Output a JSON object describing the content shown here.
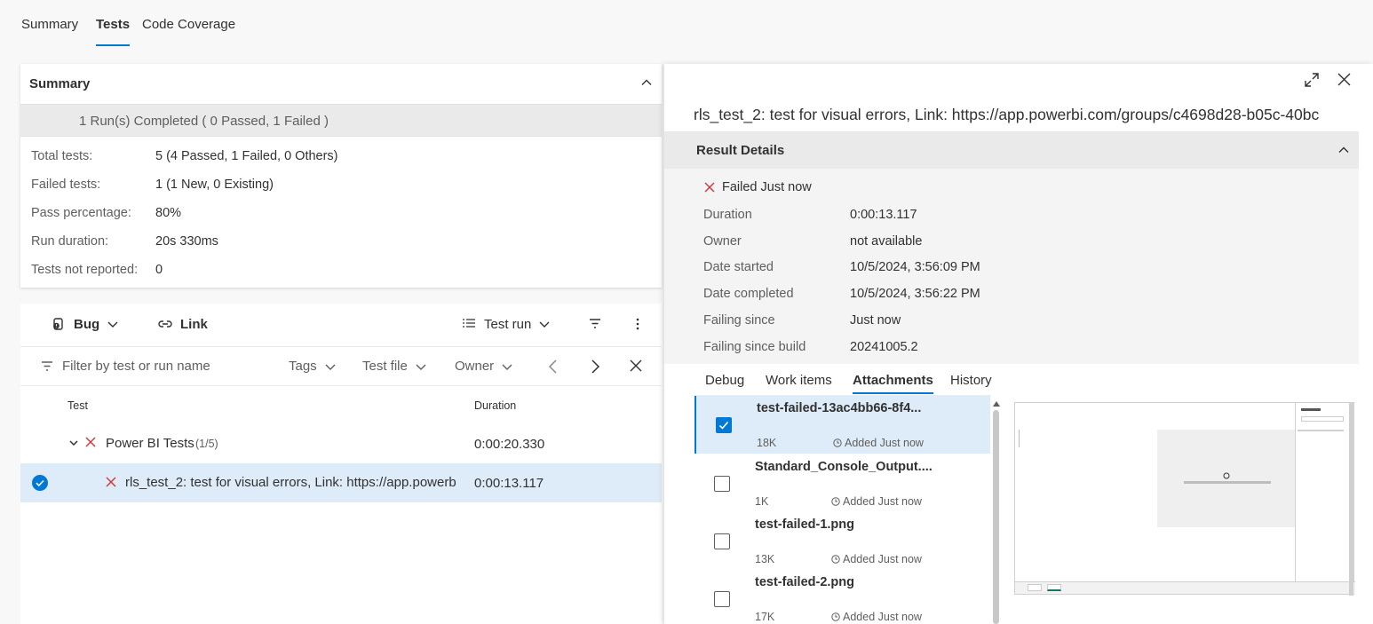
{
  "top_tabs": [
    {
      "label": "Summary"
    },
    {
      "label": "Tests"
    },
    {
      "label": "Code Coverage"
    }
  ],
  "summary": {
    "title": "Summary",
    "banner": "1 Run(s) Completed ( 0 Passed, 1 Failed )",
    "rows": [
      {
        "label": "Total tests:",
        "value": "5 (4 Passed, 1 Failed, 0 Others)"
      },
      {
        "label": "Failed tests:",
        "value": "1 (1 New, 0 Existing)"
      },
      {
        "label": "Pass percentage:",
        "value": "80%"
      },
      {
        "label": "Run duration:",
        "value": "20s 330ms"
      },
      {
        "label": "Tests not reported:",
        "value": "0"
      }
    ]
  },
  "toolbar": {
    "bug_label": "Bug",
    "link_label": "Link",
    "testrun_label": "Test run"
  },
  "filter": {
    "placeholder": "Filter by test or run name",
    "tags": "Tags",
    "test_file": "Test file",
    "owner": "Owner"
  },
  "table": {
    "col_test": "Test",
    "col_duration": "Duration",
    "group": {
      "name": "Power BI Tests",
      "count": "(1/5)",
      "duration": "0:00:20.330"
    },
    "selected_row": {
      "name": "rls_test_2: test for visual errors, Link: https://app.powerb",
      "duration": "0:00:13.117"
    }
  },
  "detail": {
    "title": "rls_test_2: test for visual errors, Link: https://app.powerbi.com/groups/c4698d28-b05c-40bc",
    "section_title": "Result Details",
    "status": "Failed Just now",
    "rows": [
      {
        "label": "Duration",
        "value": "0:00:13.117"
      },
      {
        "label": "Owner",
        "value": "not available"
      },
      {
        "label": "Date started",
        "value": "10/5/2024, 3:56:09 PM"
      },
      {
        "label": "Date completed",
        "value": "10/5/2024, 3:56:22 PM"
      },
      {
        "label": "Failing since",
        "value": "Just now"
      },
      {
        "label": "Failing since build",
        "value": "20241005.2"
      }
    ],
    "tabs": [
      {
        "label": "Debug"
      },
      {
        "label": "Work items"
      },
      {
        "label": "Attachments"
      },
      {
        "label": "History"
      }
    ],
    "attachments": [
      {
        "name": "test-failed-13ac4bb66-8f4...",
        "size": "18K",
        "added": "Added Just now"
      },
      {
        "name": "Standard_Console_Output....",
        "size": "1K",
        "added": "Added Just now"
      },
      {
        "name": "test-failed-1.png",
        "size": "13K",
        "added": "Added Just now"
      },
      {
        "name": "test-failed-2.png",
        "size": "17K",
        "added": "Added Just now"
      }
    ]
  },
  "colors": {
    "accent": "#0078d4",
    "fail_red": "#d13438",
    "selected_bg": "#deecf9"
  },
  "icons": [
    "chevron-up-icon",
    "bug-icon",
    "link-icon",
    "list-icon",
    "filter-icon",
    "more-icon",
    "chevron-left-icon",
    "chevron-right-icon",
    "close-icon",
    "expand-icon",
    "fail-x-icon",
    "clock-icon",
    "checkmark-icon"
  ]
}
